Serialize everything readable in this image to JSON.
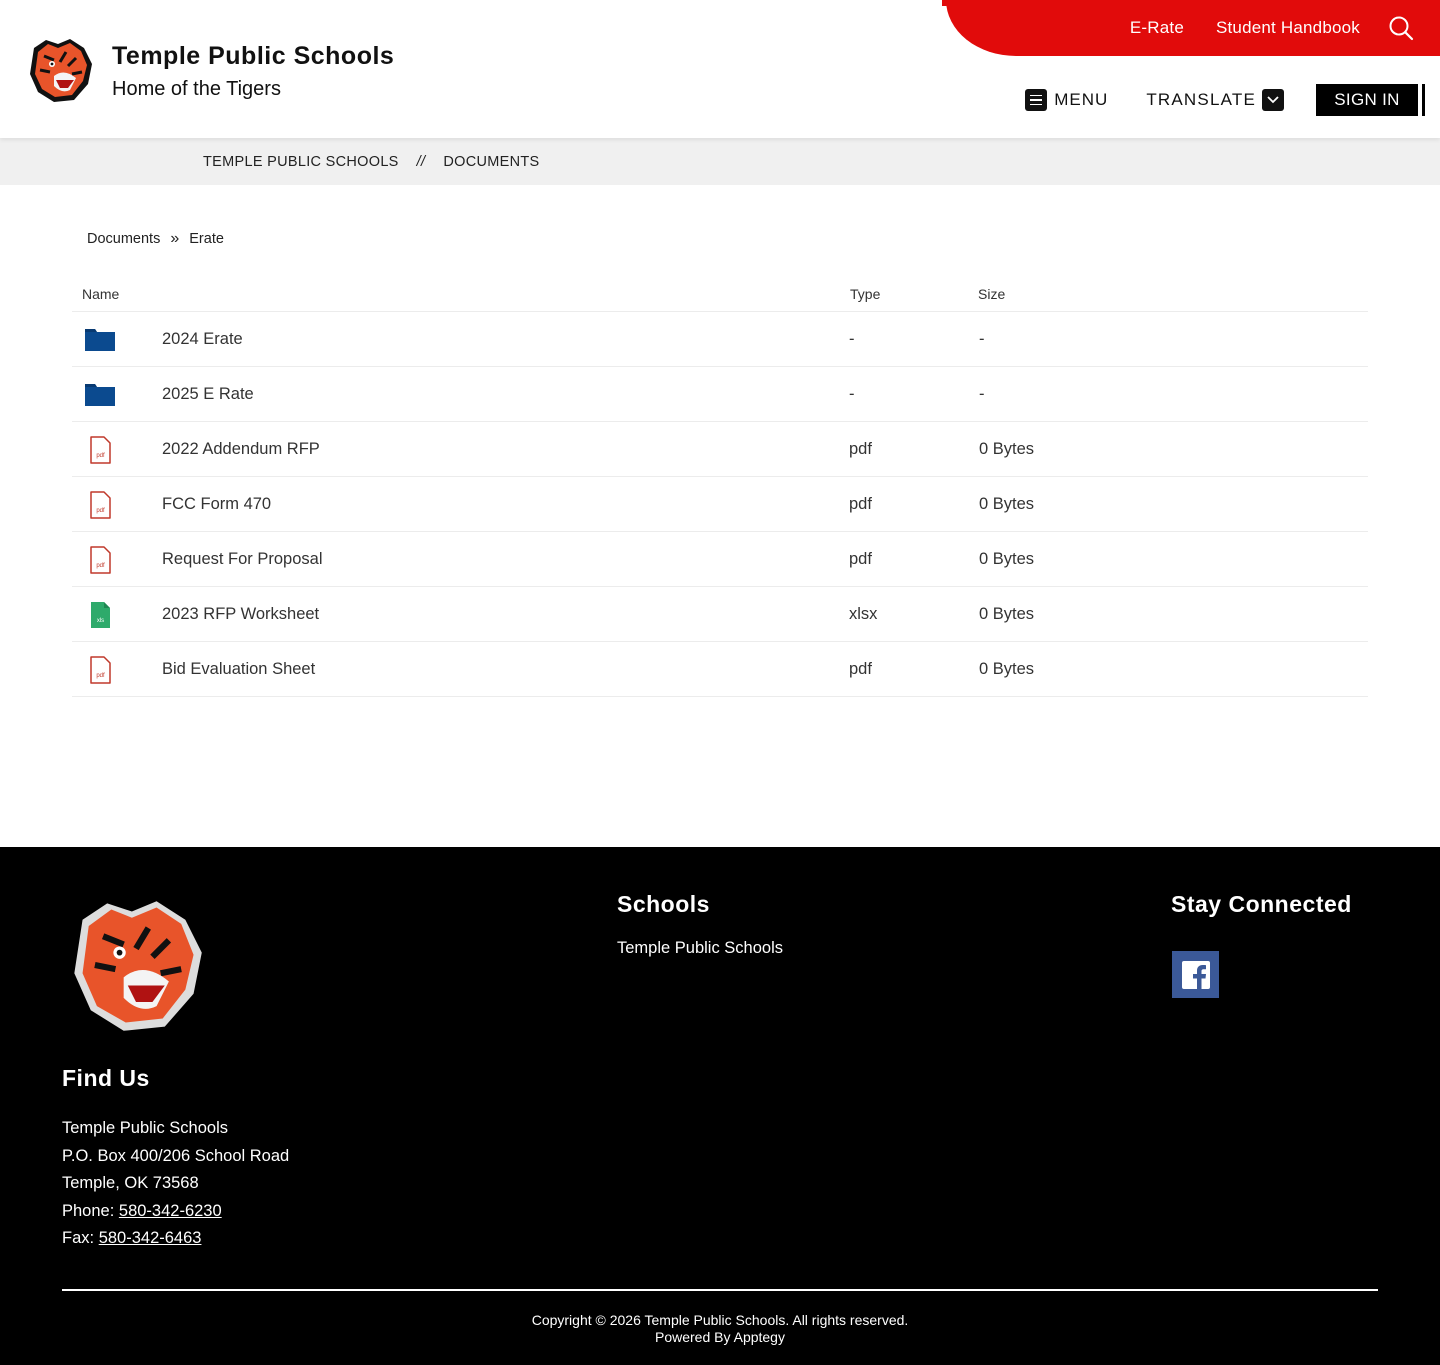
{
  "header": {
    "school_name": "Temple Public Schools",
    "tagline": "Home of the Tigers",
    "top_links": [
      "E-Rate",
      "Student Handbook"
    ],
    "menu_label": "MENU",
    "translate_label": "TRANSLATE",
    "signin_label": "SIGN IN",
    "accent_color": "#e10b0b"
  },
  "breadcrumb": {
    "home": "TEMPLE PUBLIC SCHOOLS",
    "separator": "//",
    "current": "DOCUMENTS"
  },
  "doc_path": {
    "root": "Documents",
    "current": "Erate"
  },
  "table": {
    "headers": {
      "name": "Name",
      "type": "Type",
      "size": "Size"
    },
    "rows": [
      {
        "icon": "folder-icon",
        "name": "2024 Erate",
        "type": "-",
        "size": "-"
      },
      {
        "icon": "folder-icon",
        "name": "2025 E Rate",
        "type": "-",
        "size": "-"
      },
      {
        "icon": "pdf-icon",
        "name": "2022 Addendum RFP",
        "type": "pdf",
        "size": "0 Bytes"
      },
      {
        "icon": "pdf-icon",
        "name": "FCC Form 470",
        "type": "pdf",
        "size": "0 Bytes"
      },
      {
        "icon": "pdf-icon",
        "name": "Request For Proposal",
        "type": "pdf",
        "size": "0 Bytes"
      },
      {
        "icon": "xls-icon",
        "name": "2023 RFP Worksheet",
        "type": "xlsx",
        "size": "0 Bytes"
      },
      {
        "icon": "pdf-icon",
        "name": "Bid Evaluation Sheet",
        "type": "pdf",
        "size": "0 Bytes"
      }
    ]
  },
  "footer": {
    "find_us_heading": "Find Us",
    "address_name": "Temple Public Schools",
    "address_line1": "P.O. Box 400/206 School Road",
    "address_line2": "Temple, OK 73568",
    "phone_label": "Phone:",
    "phone": "580-342-6230",
    "fax_label": "Fax:",
    "fax": "580-342-6463",
    "schools_heading": "Schools",
    "schools_link": "Temple Public Schools",
    "stay_connected_heading": "Stay Connected",
    "copyright": "Copyright © 2026 Temple Public Schools. All rights reserved.",
    "powered_by": "Powered By Apptegy"
  },
  "colors": {
    "folder": "#0b4a8f",
    "pdf": "#c0392b",
    "xls": "#2eaa6b",
    "facebook": "#3b5998"
  }
}
